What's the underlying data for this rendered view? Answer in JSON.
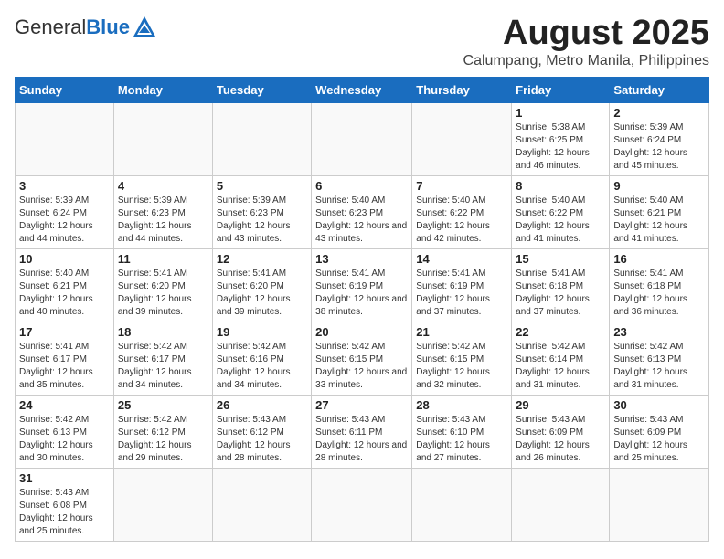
{
  "header": {
    "logo_general": "General",
    "logo_blue": "Blue",
    "title": "August 2025",
    "subtitle": "Calumpang, Metro Manila, Philippines"
  },
  "weekdays": [
    "Sunday",
    "Monday",
    "Tuesday",
    "Wednesday",
    "Thursday",
    "Friday",
    "Saturday"
  ],
  "weeks": [
    [
      {
        "day": "",
        "info": ""
      },
      {
        "day": "",
        "info": ""
      },
      {
        "day": "",
        "info": ""
      },
      {
        "day": "",
        "info": ""
      },
      {
        "day": "",
        "info": ""
      },
      {
        "day": "1",
        "info": "Sunrise: 5:38 AM\nSunset: 6:25 PM\nDaylight: 12 hours and 46 minutes."
      },
      {
        "day": "2",
        "info": "Sunrise: 5:39 AM\nSunset: 6:24 PM\nDaylight: 12 hours and 45 minutes."
      }
    ],
    [
      {
        "day": "3",
        "info": "Sunrise: 5:39 AM\nSunset: 6:24 PM\nDaylight: 12 hours and 44 minutes."
      },
      {
        "day": "4",
        "info": "Sunrise: 5:39 AM\nSunset: 6:23 PM\nDaylight: 12 hours and 44 minutes."
      },
      {
        "day": "5",
        "info": "Sunrise: 5:39 AM\nSunset: 6:23 PM\nDaylight: 12 hours and 43 minutes."
      },
      {
        "day": "6",
        "info": "Sunrise: 5:40 AM\nSunset: 6:23 PM\nDaylight: 12 hours and 43 minutes."
      },
      {
        "day": "7",
        "info": "Sunrise: 5:40 AM\nSunset: 6:22 PM\nDaylight: 12 hours and 42 minutes."
      },
      {
        "day": "8",
        "info": "Sunrise: 5:40 AM\nSunset: 6:22 PM\nDaylight: 12 hours and 41 minutes."
      },
      {
        "day": "9",
        "info": "Sunrise: 5:40 AM\nSunset: 6:21 PM\nDaylight: 12 hours and 41 minutes."
      }
    ],
    [
      {
        "day": "10",
        "info": "Sunrise: 5:40 AM\nSunset: 6:21 PM\nDaylight: 12 hours and 40 minutes."
      },
      {
        "day": "11",
        "info": "Sunrise: 5:41 AM\nSunset: 6:20 PM\nDaylight: 12 hours and 39 minutes."
      },
      {
        "day": "12",
        "info": "Sunrise: 5:41 AM\nSunset: 6:20 PM\nDaylight: 12 hours and 39 minutes."
      },
      {
        "day": "13",
        "info": "Sunrise: 5:41 AM\nSunset: 6:19 PM\nDaylight: 12 hours and 38 minutes."
      },
      {
        "day": "14",
        "info": "Sunrise: 5:41 AM\nSunset: 6:19 PM\nDaylight: 12 hours and 37 minutes."
      },
      {
        "day": "15",
        "info": "Sunrise: 5:41 AM\nSunset: 6:18 PM\nDaylight: 12 hours and 37 minutes."
      },
      {
        "day": "16",
        "info": "Sunrise: 5:41 AM\nSunset: 6:18 PM\nDaylight: 12 hours and 36 minutes."
      }
    ],
    [
      {
        "day": "17",
        "info": "Sunrise: 5:41 AM\nSunset: 6:17 PM\nDaylight: 12 hours and 35 minutes."
      },
      {
        "day": "18",
        "info": "Sunrise: 5:42 AM\nSunset: 6:17 PM\nDaylight: 12 hours and 34 minutes."
      },
      {
        "day": "19",
        "info": "Sunrise: 5:42 AM\nSunset: 6:16 PM\nDaylight: 12 hours and 34 minutes."
      },
      {
        "day": "20",
        "info": "Sunrise: 5:42 AM\nSunset: 6:15 PM\nDaylight: 12 hours and 33 minutes."
      },
      {
        "day": "21",
        "info": "Sunrise: 5:42 AM\nSunset: 6:15 PM\nDaylight: 12 hours and 32 minutes."
      },
      {
        "day": "22",
        "info": "Sunrise: 5:42 AM\nSunset: 6:14 PM\nDaylight: 12 hours and 31 minutes."
      },
      {
        "day": "23",
        "info": "Sunrise: 5:42 AM\nSunset: 6:13 PM\nDaylight: 12 hours and 31 minutes."
      }
    ],
    [
      {
        "day": "24",
        "info": "Sunrise: 5:42 AM\nSunset: 6:13 PM\nDaylight: 12 hours and 30 minutes."
      },
      {
        "day": "25",
        "info": "Sunrise: 5:42 AM\nSunset: 6:12 PM\nDaylight: 12 hours and 29 minutes."
      },
      {
        "day": "26",
        "info": "Sunrise: 5:43 AM\nSunset: 6:12 PM\nDaylight: 12 hours and 28 minutes."
      },
      {
        "day": "27",
        "info": "Sunrise: 5:43 AM\nSunset: 6:11 PM\nDaylight: 12 hours and 28 minutes."
      },
      {
        "day": "28",
        "info": "Sunrise: 5:43 AM\nSunset: 6:10 PM\nDaylight: 12 hours and 27 minutes."
      },
      {
        "day": "29",
        "info": "Sunrise: 5:43 AM\nSunset: 6:09 PM\nDaylight: 12 hours and 26 minutes."
      },
      {
        "day": "30",
        "info": "Sunrise: 5:43 AM\nSunset: 6:09 PM\nDaylight: 12 hours and 25 minutes."
      }
    ],
    [
      {
        "day": "31",
        "info": "Sunrise: 5:43 AM\nSunset: 6:08 PM\nDaylight: 12 hours and 25 minutes."
      },
      {
        "day": "",
        "info": ""
      },
      {
        "day": "",
        "info": ""
      },
      {
        "day": "",
        "info": ""
      },
      {
        "day": "",
        "info": ""
      },
      {
        "day": "",
        "info": ""
      },
      {
        "day": "",
        "info": ""
      }
    ]
  ]
}
